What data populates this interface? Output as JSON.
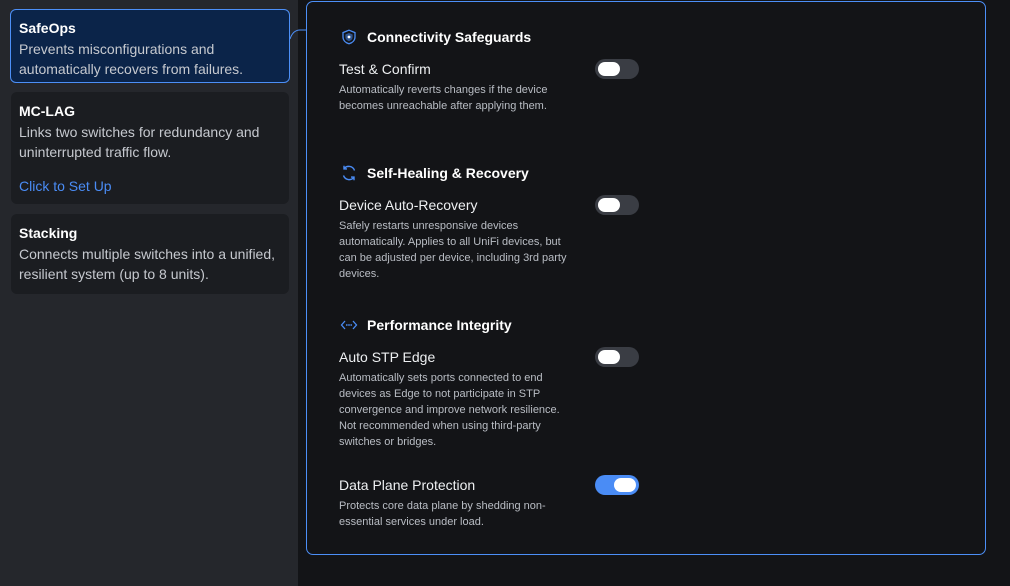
{
  "features": [
    {
      "title": "SafeOps",
      "description": "Prevents misconfigurations and automatically recovers from failures.",
      "selected": true
    },
    {
      "title": "MC-LAG",
      "description": "Links two switches for redundancy and uninterrupted traffic flow.",
      "link": "Click to Set Up"
    },
    {
      "title": "Stacking",
      "description": "Connects multiple switches into a unified, resilient system (up to 8 units)."
    }
  ],
  "sections": {
    "connectivity": {
      "icon": "shield-icon",
      "title": "Connectivity Safeguards",
      "settings": [
        {
          "label": "Test & Confirm",
          "description": "Automatically reverts changes if the device becomes unreachable after applying them.",
          "enabled": false
        }
      ]
    },
    "healing": {
      "icon": "refresh-icon",
      "title": "Self-Healing & Recovery",
      "settings": [
        {
          "label": "Device Auto-Recovery",
          "description": "Safely restarts unresponsive devices automatically. Applies to all UniFi devices, but can be adjusted per device, including 3rd party devices.",
          "enabled": false
        }
      ]
    },
    "performance": {
      "icon": "code-arrows-icon",
      "title": "Performance Integrity",
      "settings": [
        {
          "label": "Auto STP Edge",
          "description": "Automatically sets ports connected to end devices as Edge to not participate in STP convergence and improve network resilience. Not recommended when using third-party switches or bridges.",
          "enabled": false
        },
        {
          "label": "Data Plane Protection",
          "description": "Protects core data plane by shedding non-essential services under load.",
          "enabled": true
        }
      ]
    }
  },
  "colors": {
    "accent": "#4a8cf5",
    "selected_card_bg": "#0b2449",
    "panel_bg": "#131417",
    "rail_bg": "#25272c"
  }
}
